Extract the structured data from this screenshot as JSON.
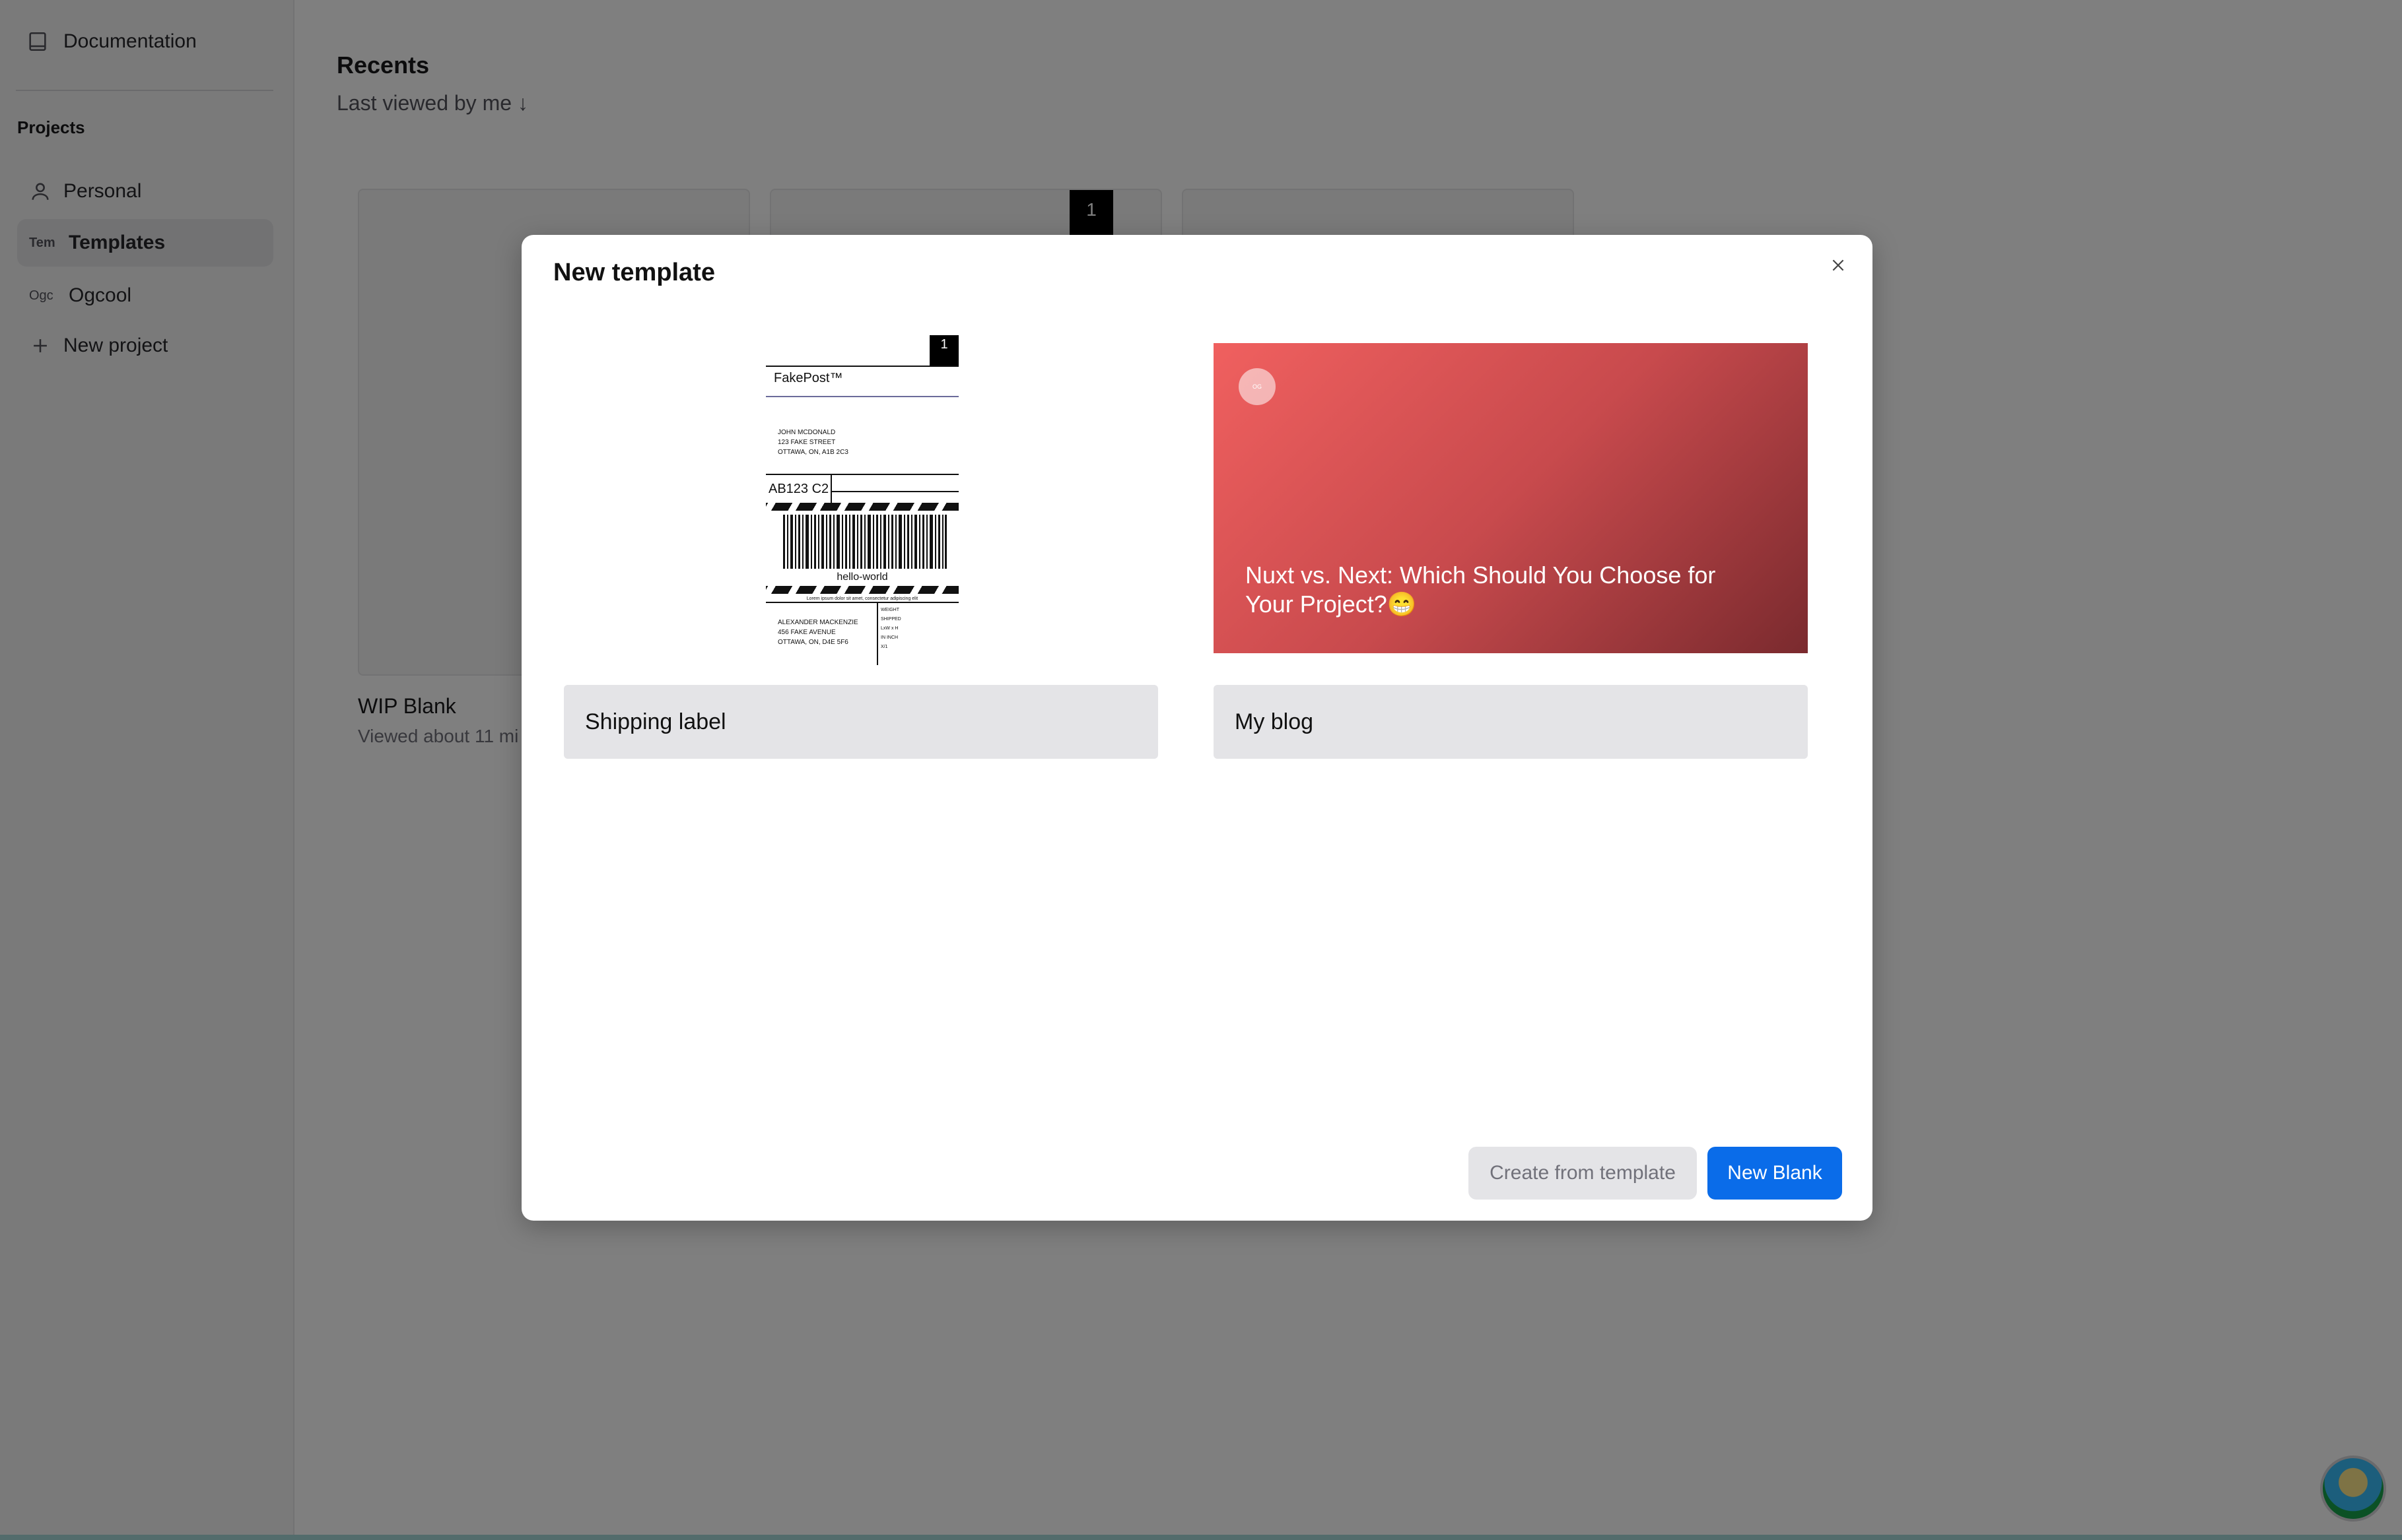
{
  "sidebar": {
    "documentation": "Documentation",
    "projects_heading": "Projects",
    "items": [
      {
        "abbr": "",
        "label": "Personal"
      },
      {
        "abbr": "Tem",
        "label": "Templates"
      },
      {
        "abbr": "Ogc",
        "label": "Ogcool"
      },
      {
        "abbr": "",
        "label": "New project"
      }
    ]
  },
  "main": {
    "title": "Recents",
    "sort": "Last viewed by me ↓",
    "cards": [
      {
        "title": "WIP Blank",
        "subtitle": "Viewed about 11 mi",
        "badge": ""
      },
      {
        "title": "",
        "subtitle": "",
        "badge": "1"
      },
      {
        "title": "",
        "subtitle": "",
        "badge": ""
      }
    ]
  },
  "modal": {
    "title": "New template",
    "close_icon": "close-icon",
    "templates": [
      {
        "label": "Shipping label",
        "preview": {
          "page_number": "1",
          "carrier": "FakePost™",
          "from_address": [
            "JOHN MCDONALD",
            "123 FAKE STREET",
            "OTTAWA, ON, A1B 2C3"
          ],
          "postal_code": "AB123 C2",
          "barcode_text": "hello-world",
          "fine_print": "Lorem ipsum dolor sit amet, consectetur adipiscing elit",
          "to_address": [
            "ALEXANDER MACKENZIE",
            "456 FAKE AVENUE",
            "OTTAWA, ON, D4E 5F6"
          ],
          "side_info": [
            "WEIGHT",
            "SHIPPED",
            "LxW x H",
            "IN INCH",
            "X/1"
          ]
        }
      },
      {
        "label": "My blog",
        "preview": {
          "avatar_text": "OG",
          "headline": "Nuxt vs. Next: Which Should You Choose for Your Project?😁"
        }
      }
    ],
    "buttons": {
      "secondary": "Create from template",
      "primary": "New Blank"
    }
  },
  "colors": {
    "primary": "#0a6ce9",
    "overlay": "rgba(0,0,0,0.5)",
    "blog_gradient_start": "#f0605f",
    "blog_gradient_end": "#7a2a2e"
  }
}
